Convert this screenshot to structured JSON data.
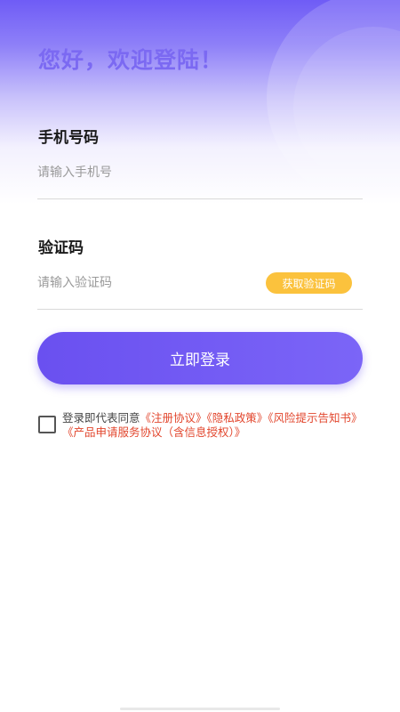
{
  "greeting": "您好，欢迎登陆！",
  "phone": {
    "label": "手机号码",
    "placeholder": "请输入手机号"
  },
  "code": {
    "label": "验证码",
    "placeholder": "请输入验证码",
    "button": "获取验证码"
  },
  "login_button": "立即登录",
  "agreement": {
    "prefix": "登录即代表同意",
    "links": [
      "《注册协议》",
      "《隐私政策》",
      "《风险提示告知书》",
      "《产品申请服务协议（含信息授权）》"
    ]
  },
  "colors": {
    "accent": "#6a50f0",
    "code_button": "#fbc23d",
    "link": "#e2462d"
  }
}
